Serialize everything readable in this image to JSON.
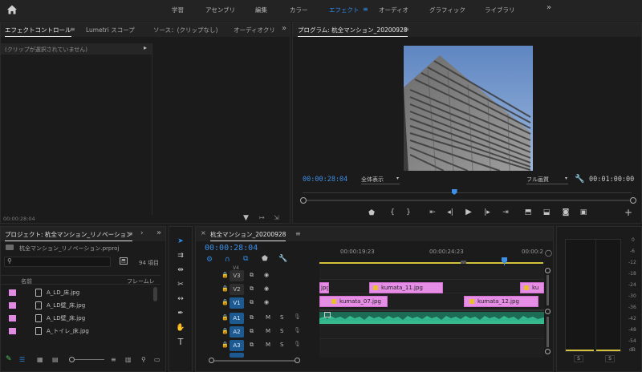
{
  "topbar": {
    "workspaces": [
      "学習",
      "アセンブリ",
      "編集",
      "カラー",
      "エフェクト",
      "オーディオ",
      "グラフィック",
      "ライブラリ"
    ],
    "active": "エフェクト",
    "more": "»"
  },
  "effect_controls": {
    "tabs": [
      "エフェクトコントロール",
      "Lumetri スコープ",
      "ソース：(クリップなし)",
      "オーディオクリ"
    ],
    "no_clip": "(クリップが選択されていません)",
    "timecode": "00:00:28:04"
  },
  "program": {
    "title": "プログラム: 杭全マンション_20200928",
    "current_tc": "00:00:28:04",
    "fit": "全体表示",
    "quality": "フル画質",
    "duration_tc": "00:01:00:00",
    "playhead_fraction": 0.46
  },
  "project": {
    "title": "プロジェクト: 杭全マンション_リノベーション",
    "file": "杭全マンション_リノベーション.prproj",
    "count": "94 項目",
    "col_name": "名前",
    "col_fps": "フレームレ",
    "items": [
      "A_LD_床.jpg",
      "A_LD壁_床.jpg",
      "A_LD壁_床.jpg",
      "A_トイレ_床.jpg"
    ]
  },
  "timeline": {
    "sequence": "杭全マンション_20200928",
    "timecode": "00:00:28:04",
    "ruler": [
      "00:00:19:23",
      "00:00:24:23",
      "00:00:2"
    ],
    "tracks": [
      "V4",
      "V3",
      "V2",
      "V1",
      "A1",
      "A2",
      "A3"
    ],
    "clips_v2": [
      "jpg",
      "kumata_11.jpg",
      "ku"
    ],
    "clips_v1": [
      "kumata_07.jpg",
      "kumata_12.jpg"
    ],
    "audio_letters": {
      "m": "M",
      "s": "S"
    }
  },
  "audio_meter": {
    "scale": [
      "0",
      "-6",
      "-12",
      "-18",
      "-24",
      "-30",
      "-36",
      "-42",
      "-48",
      "-54",
      "dB"
    ],
    "solo": [
      "S",
      "S"
    ]
  },
  "colors": {
    "accent": "#2d8ceb",
    "clip": "#e68ee6",
    "audio": "#2fa77a",
    "sel_track": "#1e5a92"
  }
}
